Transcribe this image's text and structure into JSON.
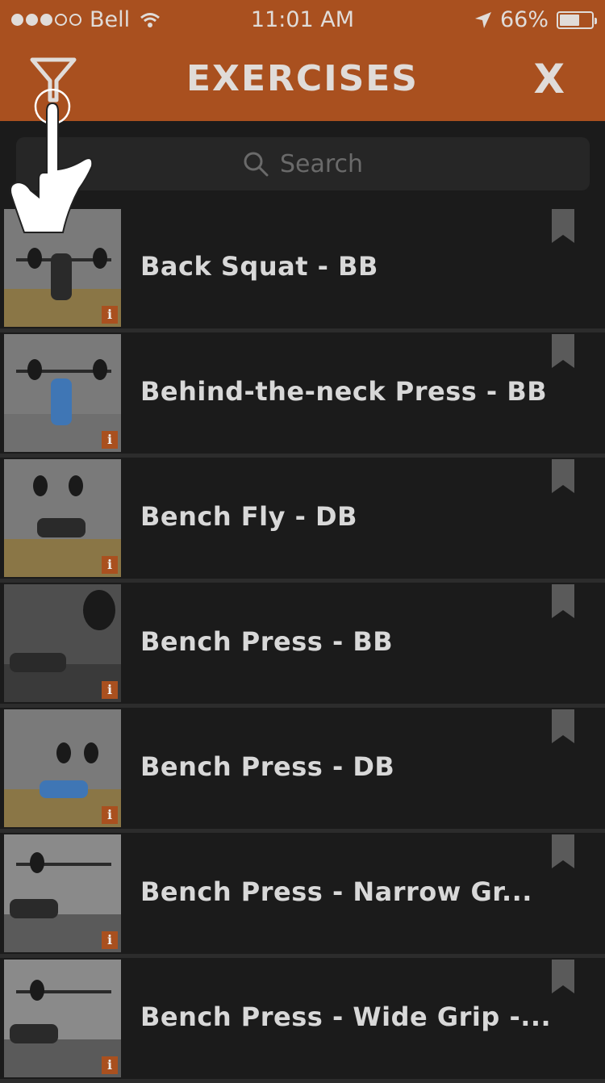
{
  "status_bar": {
    "carrier": "Bell",
    "time": "11:01 AM",
    "battery": "66%",
    "battery_level": 0.66
  },
  "header": {
    "title": "EXERCISES",
    "close_label": "X"
  },
  "search": {
    "placeholder": "Search"
  },
  "exercises": [
    {
      "name": "Back Squat - BB"
    },
    {
      "name": "Behind-the-neck Press - BB"
    },
    {
      "name": "Bench Fly - DB"
    },
    {
      "name": "Bench Press - BB"
    },
    {
      "name": "Bench Press - DB"
    },
    {
      "name": "Bench Press - Narrow  Gr..."
    },
    {
      "name": "Bench Press - Wide Grip -..."
    }
  ],
  "info_badge": "i",
  "colors": {
    "accent": "#a9501f",
    "background": "#1b1b1b",
    "text": "#d8d8d8"
  }
}
